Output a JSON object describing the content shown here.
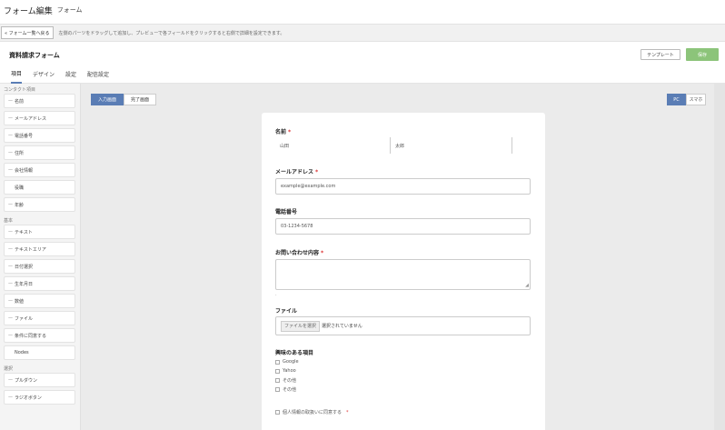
{
  "topbar": {
    "title": "フォーム編集",
    "subtitle": "フォーム"
  },
  "infobar": {
    "back_label": "« フォーム一覧へ戻る",
    "info_text": "左側のパーツをドラッグして追加し、プレビューで各フィールドをクリックすると右側で詳細を設定できます。"
  },
  "form_header": {
    "title": "資料請求フォーム",
    "template_label": "テンプレート",
    "save_label": "保存"
  },
  "tabs": [
    {
      "label": "項目"
    },
    {
      "label": "デザイン"
    },
    {
      "label": "設定"
    },
    {
      "label": "配信設定"
    }
  ],
  "sidebar": {
    "sections": [
      {
        "heading": "コンタクト項目",
        "items": [
          "名前",
          "メールアドレス",
          "電話番号",
          "住所",
          "会社情報",
          "役職",
          "年齢"
        ]
      },
      {
        "heading": "基本",
        "items": [
          "テキスト",
          "テキストエリア",
          "日付選択",
          "生年月日",
          "数値",
          "ファイル",
          "条件に同意する",
          "Nodes"
        ]
      },
      {
        "heading": "選択",
        "items": [
          "プルダウン",
          "ラジオボタン"
        ]
      }
    ]
  },
  "canvas": {
    "mode_tabs": [
      {
        "label": "入力画面"
      },
      {
        "label": "完了画面"
      }
    ],
    "device_tabs": [
      {
        "label": "PC"
      },
      {
        "label": "スマホ"
      }
    ],
    "form": {
      "name_label": "名前",
      "name_last_placeholder": "山田",
      "name_first_placeholder": "太郎",
      "email_label": "メールアドレス",
      "email_placeholder": "example@example.com",
      "phone_label": "電話番号",
      "phone_placeholder": "03-1234-5678",
      "inquiry_label": "お問い合わせ内容",
      "file_label": "ファイル",
      "file_button": "ファイルを選択",
      "file_status": "選択されていません",
      "interest_label": "興味のある項目",
      "interest_options": [
        "Google",
        "Yahoo",
        "その他",
        "その他"
      ],
      "consent_label": "個人情報の取扱いに同意する",
      "required_mark": "*"
    }
  },
  "colors": {
    "accent": "#5a7db5",
    "save": "#8cc47a",
    "required": "#dd3333"
  }
}
